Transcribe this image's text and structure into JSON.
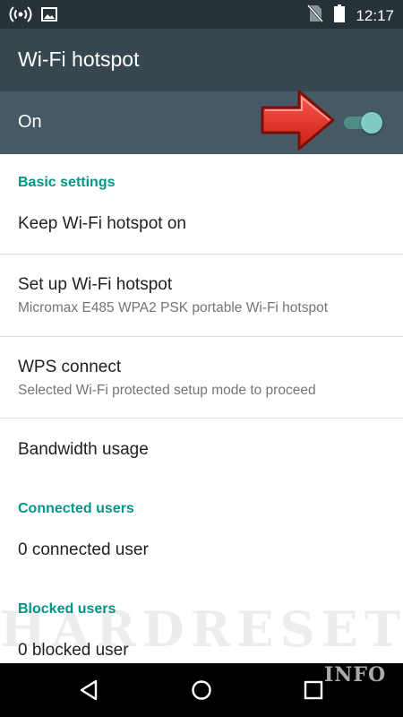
{
  "status_bar": {
    "time": "12:17",
    "icons": [
      "hotspot-icon",
      "image-icon",
      "no-sim-icon",
      "battery-icon"
    ]
  },
  "app_bar": {
    "title": "Wi-Fi hotspot"
  },
  "master_switch": {
    "label": "On",
    "state": "on",
    "accent_color": "#80cbc4"
  },
  "sections": {
    "basic": {
      "header": "Basic settings"
    },
    "connected": {
      "header": "Connected users"
    },
    "blocked": {
      "header": "Blocked users"
    }
  },
  "items": {
    "keep_on": {
      "primary": "Keep Wi-Fi hotspot on"
    },
    "setup": {
      "primary": "Set up Wi-Fi hotspot",
      "secondary": "Micromax E485 WPA2 PSK portable Wi-Fi hotspot"
    },
    "wps": {
      "primary": "WPS connect",
      "secondary": "Selected Wi-Fi protected setup mode to proceed"
    },
    "bandwidth": {
      "primary": "Bandwidth usage"
    },
    "connected_users": {
      "primary": "0 connected user"
    },
    "blocked_users": {
      "primary": "0 blocked user"
    }
  },
  "watermark": {
    "main": "HARDRESET",
    "sub": "INFO"
  },
  "nav_bar": {
    "buttons": [
      "back-icon",
      "home-icon",
      "recents-icon"
    ]
  },
  "colors": {
    "accent": "#009688",
    "app_bar": "#37474f",
    "status_bar": "#263238",
    "arrow": "#e53935"
  }
}
